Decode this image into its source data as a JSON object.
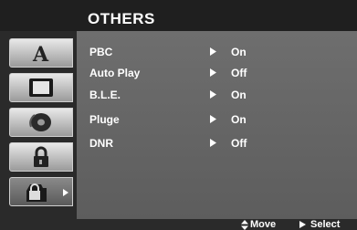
{
  "menu": {
    "title": "OTHERS",
    "tabs": [
      {
        "icon": "language-icon"
      },
      {
        "icon": "display-icon"
      },
      {
        "icon": "audio-disc-icon"
      },
      {
        "icon": "lock-icon"
      },
      {
        "icon": "others-icon",
        "active": true
      }
    ],
    "items": [
      {
        "label": "PBC",
        "value": "On"
      },
      {
        "label": "Auto Play",
        "value": "Off"
      },
      {
        "label": "B.L.E.",
        "value": "On"
      },
      {
        "label": "Pluge",
        "value": "On"
      },
      {
        "label": "DNR",
        "value": "Off"
      }
    ]
  },
  "footer": {
    "move_label": "Move",
    "select_label": "Select"
  },
  "colors": {
    "panel": "#666666",
    "tab": "#d8d8d8",
    "text": "#ffffff"
  }
}
